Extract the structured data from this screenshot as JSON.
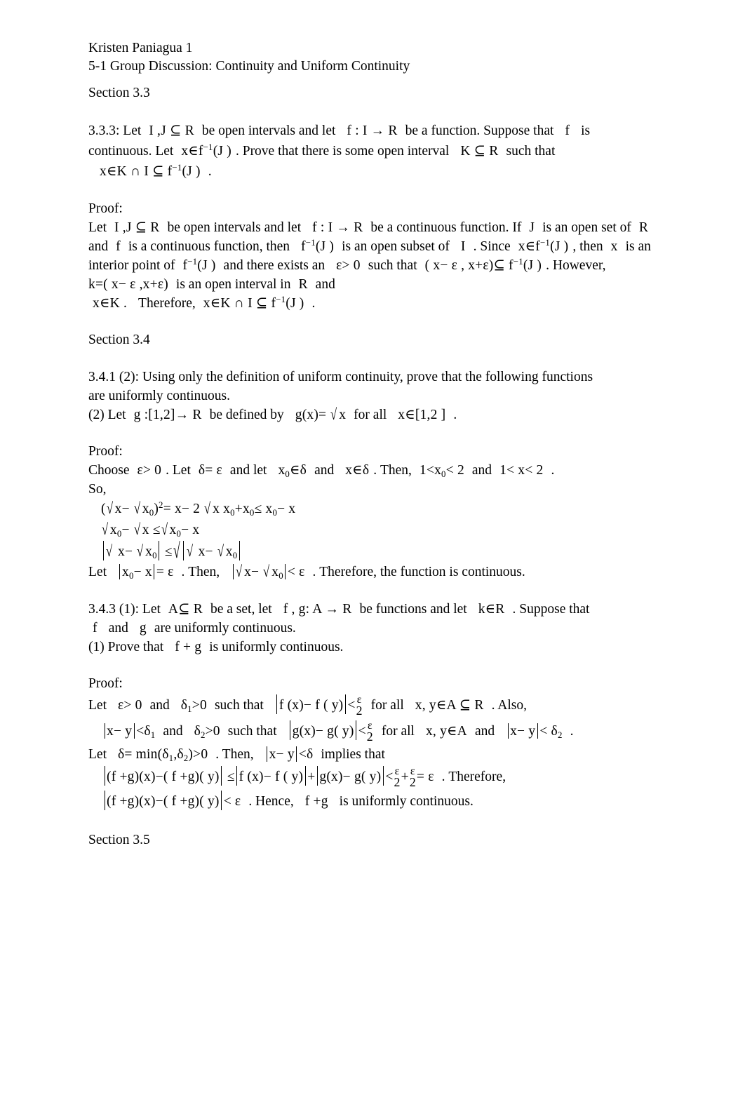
{
  "document": {
    "header": {
      "author_line": "Kristen Paniagua 1",
      "assignment_line": "5-1 Group Discussion: Continuity and Uniform Continuity"
    },
    "sections": {
      "s33": "Section 3.3",
      "s34": "Section 3.4",
      "s35": "Section 3.5"
    },
    "labels": {
      "proof": "Proof:"
    },
    "problem_333": {
      "number": "3.3.3:",
      "t1": "Let",
      "m1": "I ,J ⊆ R",
      "t2": "be open intervals and let",
      "m2": "f : I → R",
      "t3": "be a function. Suppose that",
      "m3": "f",
      "t4": "is continuous. Let",
      "m4": "x∈f ⁻¹(J )",
      "t5": ". Prove that there is some open interval",
      "m5": "K ⊆ R",
      "t6": "such that",
      "m6": "x∈K ∩ I ⊆ f ⁻¹(J )",
      "t7": "."
    },
    "proof_333": {
      "l1_t1": "Let",
      "l1_m1": "I ,J ⊆ R",
      "l1_t2": "be open intervals and let",
      "l1_m2": "f : I → R",
      "l1_t3": "be a continuous function. If",
      "l1_m3": "J",
      "l1_t4": "is an open set of",
      "l1_m4": "R",
      "l1_t5": "and",
      "l1_m5": "f",
      "l1_t6": "is a continuous function, then",
      "l1_m6": "f ⁻¹(J )",
      "l1_t7": "is an open subset of",
      "l1_m7": "I",
      "l1_t8": ".",
      "l2_t1": "Since",
      "l2_m1": "x∈f ⁻¹(J )",
      "l2_t2": ", then",
      "l2_m2": "x",
      "l2_t3": "is an interior point of",
      "l2_m3": "f ⁻¹(J )",
      "l2_t4": "and there exists an",
      "l2_m4": "ε> 0",
      "l2_t5": "such that",
      "l2_m5": "( x− ε , x+ε)⊆ f ⁻¹(J )",
      "l2_t6": ". However,",
      "l2_m6": "k=( x− ε ,x+ε)",
      "l2_t7": "is an open interval in",
      "l2_m7": "R",
      "l2_t8": "and",
      "l2_m8": "x∈K .",
      "l2_t9": "Therefore,",
      "l2_m9": "x∈K ∩ I ⊆ f ⁻¹(J )",
      "l2_t10": "."
    },
    "problem_341": {
      "line1": "3.4.1 (2): Using only the definition of uniform continuity, prove that the following functions",
      "line2": "are uniformly continuous.",
      "l3_t1": "(2) Let",
      "l3_m1": "g :[1,2]→ R",
      "l3_t2": "be defined by",
      "l3_m2": "g(x)= √x",
      "l3_t3": "for all",
      "l3_m3": "x∈[1,2 ]",
      "l3_t4": "."
    },
    "proof_341": {
      "l1_t1": "Choose",
      "l1_m1": "ε> 0",
      "l1_t2": ". Let",
      "l1_m2": "δ= ε",
      "l1_t3": "and let",
      "l1_m3": "x₀∈δ",
      "l1_t4": "and",
      "l1_m4": "x∈δ",
      "l1_t5": ". Then,",
      "l1_m5": "1<x₀< 2",
      "l1_t6": "and",
      "l1_m6": "1< x< 2",
      "l1_t7": ".",
      "l2": "So,",
      "eq1": "(√x− √x₀)² = x− 2√x x₀ +x₀ ≤ x₀− x",
      "eq2": "√x₀− √x ≤ √x₀− x",
      "eq3": "|√x− √x₀| ≤ √|√x− √x₀|",
      "l6_t1": "Let",
      "l6_m1": "|x₀− x| = ε",
      "l6_t2": ". Then,",
      "l6_m2": "|√x− √x₀|< ε",
      "l6_t3": ". Therefore, the function is continuous."
    },
    "problem_343": {
      "number": "3.4.3 (1):",
      "t1": "Let",
      "m1": "A ⊆ R",
      "t2": "be a set, let",
      "m2": "f , g: A → R",
      "t3": "be functions and let",
      "m3": "k∈R",
      "t4": ". Suppose that",
      "m4": "f",
      "t5": "and",
      "m5": "g",
      "t6": "are uniformly continuous.",
      "l3_t1": "(1) Prove that",
      "l3_m1": "f + g",
      "l3_t2": "is uniformly continuous."
    },
    "proof_343": {
      "l1_t1": "Let",
      "l1_m1": "ε> 0",
      "l1_t2": "and",
      "l1_m2": "δ₁> 0",
      "l1_t3": "such that",
      "l1_m3": "|f (x)− f ( y)|< ε/2",
      "l1_t4": "for all",
      "l1_m4": "x, y∈A ⊆ R",
      "l1_t5": ". Also,",
      "l2_m1": "|x− y|<δ₁",
      "l2_t1": "and",
      "l2_m2": "δ₂>0",
      "l2_t2": "such that",
      "l2_m3": "|g(x)− g( y)|< ε/2",
      "l2_t3": "for all",
      "l2_m4": "x, y∈A",
      "l2_t4": "and",
      "l2_m5": "|x− y|<δ₂",
      "l2_t5": ".",
      "l3_t1": "Let",
      "l3_m1": "δ= min(δ₁,δ₂)>0",
      "l3_t2": ". Then,",
      "l3_m2": "|x− y|<δ",
      "l3_t3": "implies that",
      "l4_m1": "|(f +g)(x)−( f +g)( y)| ≤|f (x)− f ( y)|+|g(x)− g( y)|< ε/2 + ε/2 = ε",
      "l4_t1": ". Therefore,",
      "l5_m1": "|(f +g)(x)−( f +g)( y)|< ε",
      "l5_t1": ". Hence,",
      "l5_m2": "f +g",
      "l5_t2": "is uniformly continuous."
    },
    "symbols": {
      "sqrt": "√",
      "epsilon": "ε",
      "delta": "δ",
      "subset_eq": "⊆",
      "element_of": "∈",
      "intersection": "∩",
      "arrow": "→",
      "leq": "≤",
      "lt": "<",
      "gt": ">",
      "two": "2",
      "zero": "0",
      "one": "1"
    },
    "colors": {
      "text": "#000000",
      "background": "#ffffff"
    }
  }
}
